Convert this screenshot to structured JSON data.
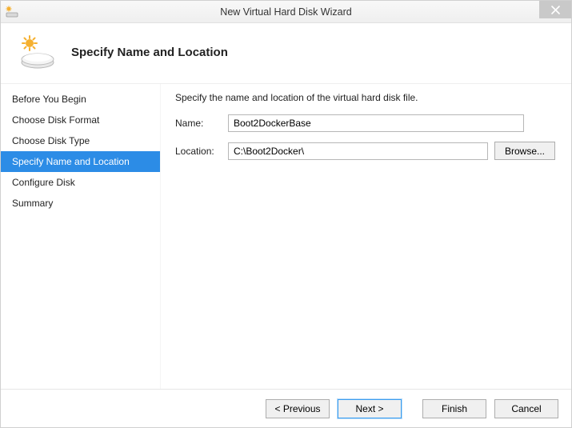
{
  "window": {
    "title": "New Virtual Hard Disk Wizard"
  },
  "header": {
    "title": "Specify Name and Location"
  },
  "sidebar": {
    "items": [
      {
        "label": "Before You Begin",
        "selected": false
      },
      {
        "label": "Choose Disk Format",
        "selected": false
      },
      {
        "label": "Choose Disk Type",
        "selected": false
      },
      {
        "label": "Specify Name and Location",
        "selected": true
      },
      {
        "label": "Configure Disk",
        "selected": false
      },
      {
        "label": "Summary",
        "selected": false
      }
    ]
  },
  "content": {
    "instruction": "Specify the name and location of the virtual hard disk file.",
    "name_label": "Name:",
    "name_value": "Boot2DockerBase",
    "location_label": "Location:",
    "location_value": "C:\\Boot2Docker\\",
    "browse_label": "Browse..."
  },
  "footer": {
    "previous": "< Previous",
    "next": "Next >",
    "finish": "Finish",
    "cancel": "Cancel"
  }
}
